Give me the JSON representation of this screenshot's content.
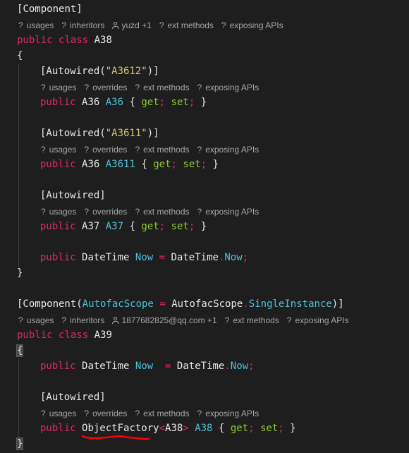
{
  "editor": {
    "classes": [
      {
        "attribute": {
          "open": "[",
          "name": "Component",
          "close": "]"
        },
        "lens": [
          {
            "type": "usages",
            "icon": "?",
            "label": "usages"
          },
          {
            "type": "inheritors",
            "icon": "?",
            "label": "inheritors"
          },
          {
            "type": "author",
            "icon": "user-icon",
            "label": "yuzd +1"
          },
          {
            "type": "ext-methods",
            "icon": "?",
            "label": "ext methods"
          },
          {
            "type": "exposing-apis",
            "icon": "?",
            "label": "exposing APIs"
          }
        ],
        "declaration": {
          "modifier": "public",
          "keyword": "class",
          "name": "A38"
        },
        "open_brace": "{",
        "close_brace": "}",
        "members": [
          {
            "attribute": "[Autowired(",
            "attribute_arg": "\"A3612\"",
            "attribute_close": ")]",
            "lens": [
              "usages",
              "overrides",
              "ext methods",
              "exposing APIs"
            ],
            "modifier": "public",
            "type": "A36",
            "name": "A36",
            "get": "get",
            "set": "set"
          },
          {
            "attribute": "[Autowired(",
            "attribute_arg": "\"A3611\"",
            "attribute_close": ")]",
            "lens": [
              "usages",
              "overrides",
              "ext methods",
              "exposing APIs"
            ],
            "modifier": "public",
            "type": "A36",
            "name": "A3611",
            "get": "get",
            "set": "set"
          },
          {
            "attribute": "[Autowired]",
            "lens": [
              "usages",
              "overrides",
              "ext methods",
              "exposing APIs"
            ],
            "modifier": "public",
            "type": "A37",
            "name": "A37",
            "get": "get",
            "set": "set"
          }
        ],
        "field": {
          "modifier": "public",
          "type": "DateTime",
          "name": "Now",
          "op": "=",
          "value_type": "DateTime",
          "value_member": "Now"
        }
      },
      {
        "attribute": {
          "open": "[Component(",
          "arg_name": "AutofacScope",
          "op": "=",
          "arg_type": "AutofacScope",
          "arg_member": "SingleInstance",
          "close": ")]"
        },
        "lens": [
          {
            "type": "usages",
            "icon": "?",
            "label": "usages"
          },
          {
            "type": "inheritors",
            "icon": "?",
            "label": "inheritors"
          },
          {
            "type": "author",
            "icon": "user-icon",
            "label": "1877682825@qq.com +1"
          },
          {
            "type": "ext-methods",
            "icon": "?",
            "label": "ext methods"
          },
          {
            "type": "exposing-apis",
            "icon": "?",
            "label": "exposing APIs"
          }
        ],
        "declaration": {
          "modifier": "public",
          "keyword": "class",
          "name": "A39"
        },
        "open_brace": "{",
        "close_brace": "}",
        "field": {
          "modifier": "public",
          "type": "DateTime",
          "name": "Now",
          "op": "=",
          "value_type": "DateTime",
          "value_member": "Now"
        },
        "member": {
          "attribute": "[Autowired]",
          "lens": [
            "usages",
            "overrides",
            "ext methods",
            "exposing APIs"
          ],
          "modifier": "public",
          "type": "ObjectFactory",
          "generic_open": "<",
          "generic_arg": "A38",
          "generic_close": ">",
          "name": "A38",
          "get": "get",
          "set": "set"
        }
      }
    ],
    "annotation": {
      "type": "red-underline",
      "target": "ObjectFactory",
      "color": "#ff0000"
    }
  }
}
